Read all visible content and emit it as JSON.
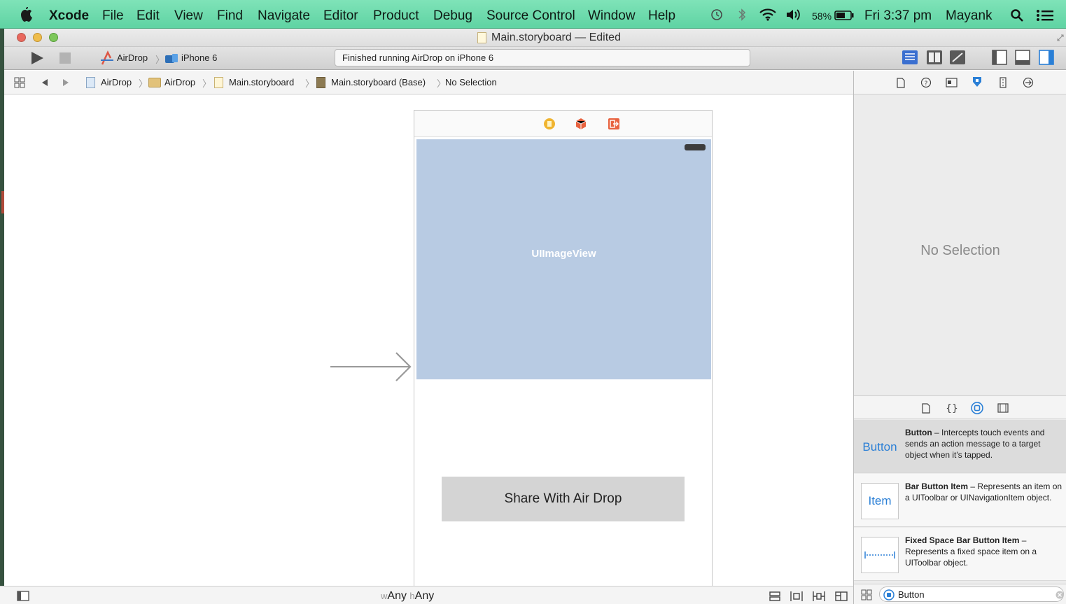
{
  "menubar": {
    "app_name": "Xcode",
    "menus": [
      "File",
      "Edit",
      "View",
      "Find",
      "Navigate",
      "Editor",
      "Product",
      "Debug",
      "Source Control",
      "Window",
      "Help"
    ],
    "battery": "58%",
    "clock": "Fri 3:37 pm",
    "user": "Mayank"
  },
  "window": {
    "title": "Main.storyboard — Edited"
  },
  "toolbar": {
    "scheme": "AirDrop",
    "device": "iPhone 6",
    "status": "Finished running AirDrop on iPhone 6"
  },
  "jumpbar": {
    "crumbs": [
      "AirDrop",
      "AirDrop",
      "Main.storyboard",
      "Main.storyboard (Base)",
      "No Selection"
    ]
  },
  "canvas": {
    "image_view_label": "UIImageView",
    "button_title": "Share With Air Drop",
    "size_class": {
      "w_prefix": "w",
      "w_value": "Any",
      "h_prefix": "h",
      "h_value": "Any"
    }
  },
  "inspector": {
    "placeholder": "No Selection",
    "library": [
      {
        "thumb": "Button",
        "name": "Button",
        "description": " – Intercepts touch events and sends an action message to a target object when it's tapped."
      },
      {
        "thumb": "Item",
        "name": "Bar Button Item",
        "description": " – Represents an item on a UIToolbar or UINavigationItem object."
      },
      {
        "thumb": "",
        "name": "Fixed Space Bar Button Item",
        "description": " – Represents a fixed space item on a UIToolbar object."
      }
    ],
    "filter_value": "Button"
  },
  "colors": {
    "menubar": "#6fdcb0",
    "image_view": "#b8cbe3",
    "button_bg": "#d4d4d4",
    "accent_blue": "#2a7fd6"
  }
}
